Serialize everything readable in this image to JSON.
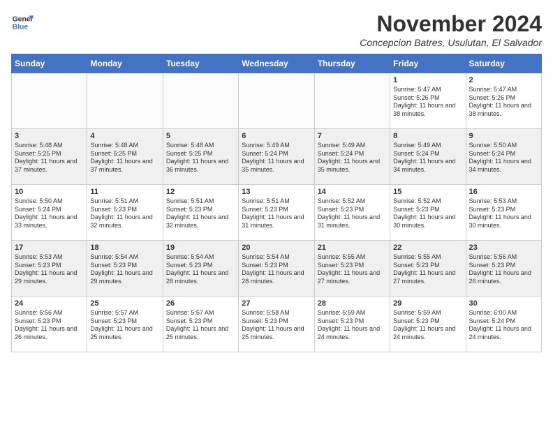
{
  "logo": {
    "line1": "General",
    "line2": "Blue"
  },
  "header": {
    "month_year": "November 2024",
    "location": "Concepcion Batres, Usulutan, El Salvador"
  },
  "days_of_week": [
    "Sunday",
    "Monday",
    "Tuesday",
    "Wednesday",
    "Thursday",
    "Friday",
    "Saturday"
  ],
  "weeks": [
    [
      {
        "day": "",
        "info": ""
      },
      {
        "day": "",
        "info": ""
      },
      {
        "day": "",
        "info": ""
      },
      {
        "day": "",
        "info": ""
      },
      {
        "day": "",
        "info": ""
      },
      {
        "day": "1",
        "info": "Sunrise: 5:47 AM\nSunset: 5:26 PM\nDaylight: 11 hours and 38 minutes."
      },
      {
        "day": "2",
        "info": "Sunrise: 5:47 AM\nSunset: 5:26 PM\nDaylight: 11 hours and 38 minutes."
      }
    ],
    [
      {
        "day": "3",
        "info": "Sunrise: 5:48 AM\nSunset: 5:25 PM\nDaylight: 11 hours and 37 minutes."
      },
      {
        "day": "4",
        "info": "Sunrise: 5:48 AM\nSunset: 5:25 PM\nDaylight: 11 hours and 37 minutes."
      },
      {
        "day": "5",
        "info": "Sunrise: 5:48 AM\nSunset: 5:25 PM\nDaylight: 11 hours and 36 minutes."
      },
      {
        "day": "6",
        "info": "Sunrise: 5:49 AM\nSunset: 5:24 PM\nDaylight: 11 hours and 35 minutes."
      },
      {
        "day": "7",
        "info": "Sunrise: 5:49 AM\nSunset: 5:24 PM\nDaylight: 11 hours and 35 minutes."
      },
      {
        "day": "8",
        "info": "Sunrise: 5:49 AM\nSunset: 5:24 PM\nDaylight: 11 hours and 34 minutes."
      },
      {
        "day": "9",
        "info": "Sunrise: 5:50 AM\nSunset: 5:24 PM\nDaylight: 11 hours and 34 minutes."
      }
    ],
    [
      {
        "day": "10",
        "info": "Sunrise: 5:50 AM\nSunset: 5:24 PM\nDaylight: 11 hours and 33 minutes."
      },
      {
        "day": "11",
        "info": "Sunrise: 5:51 AM\nSunset: 5:23 PM\nDaylight: 11 hours and 32 minutes."
      },
      {
        "day": "12",
        "info": "Sunrise: 5:51 AM\nSunset: 5:23 PM\nDaylight: 11 hours and 32 minutes."
      },
      {
        "day": "13",
        "info": "Sunrise: 5:51 AM\nSunset: 5:23 PM\nDaylight: 11 hours and 31 minutes."
      },
      {
        "day": "14",
        "info": "Sunrise: 5:52 AM\nSunset: 5:23 PM\nDaylight: 11 hours and 31 minutes."
      },
      {
        "day": "15",
        "info": "Sunrise: 5:52 AM\nSunset: 5:23 PM\nDaylight: 11 hours and 30 minutes."
      },
      {
        "day": "16",
        "info": "Sunrise: 5:53 AM\nSunset: 5:23 PM\nDaylight: 11 hours and 30 minutes."
      }
    ],
    [
      {
        "day": "17",
        "info": "Sunrise: 5:53 AM\nSunset: 5:23 PM\nDaylight: 11 hours and 29 minutes."
      },
      {
        "day": "18",
        "info": "Sunrise: 5:54 AM\nSunset: 5:23 PM\nDaylight: 11 hours and 29 minutes."
      },
      {
        "day": "19",
        "info": "Sunrise: 5:54 AM\nSunset: 5:23 PM\nDaylight: 11 hours and 28 minutes."
      },
      {
        "day": "20",
        "info": "Sunrise: 5:54 AM\nSunset: 5:23 PM\nDaylight: 11 hours and 28 minutes."
      },
      {
        "day": "21",
        "info": "Sunrise: 5:55 AM\nSunset: 5:23 PM\nDaylight: 11 hours and 27 minutes."
      },
      {
        "day": "22",
        "info": "Sunrise: 5:55 AM\nSunset: 5:23 PM\nDaylight: 11 hours and 27 minutes."
      },
      {
        "day": "23",
        "info": "Sunrise: 5:56 AM\nSunset: 5:23 PM\nDaylight: 11 hours and 26 minutes."
      }
    ],
    [
      {
        "day": "24",
        "info": "Sunrise: 5:56 AM\nSunset: 5:23 PM\nDaylight: 11 hours and 26 minutes."
      },
      {
        "day": "25",
        "info": "Sunrise: 5:57 AM\nSunset: 5:23 PM\nDaylight: 11 hours and 25 minutes."
      },
      {
        "day": "26",
        "info": "Sunrise: 5:57 AM\nSunset: 5:23 PM\nDaylight: 11 hours and 25 minutes."
      },
      {
        "day": "27",
        "info": "Sunrise: 5:58 AM\nSunset: 5:23 PM\nDaylight: 11 hours and 25 minutes."
      },
      {
        "day": "28",
        "info": "Sunrise: 5:59 AM\nSunset: 5:23 PM\nDaylight: 11 hours and 24 minutes."
      },
      {
        "day": "29",
        "info": "Sunrise: 5:59 AM\nSunset: 5:23 PM\nDaylight: 11 hours and 24 minutes."
      },
      {
        "day": "30",
        "info": "Sunrise: 6:00 AM\nSunset: 5:24 PM\nDaylight: 11 hours and 24 minutes."
      }
    ]
  ]
}
